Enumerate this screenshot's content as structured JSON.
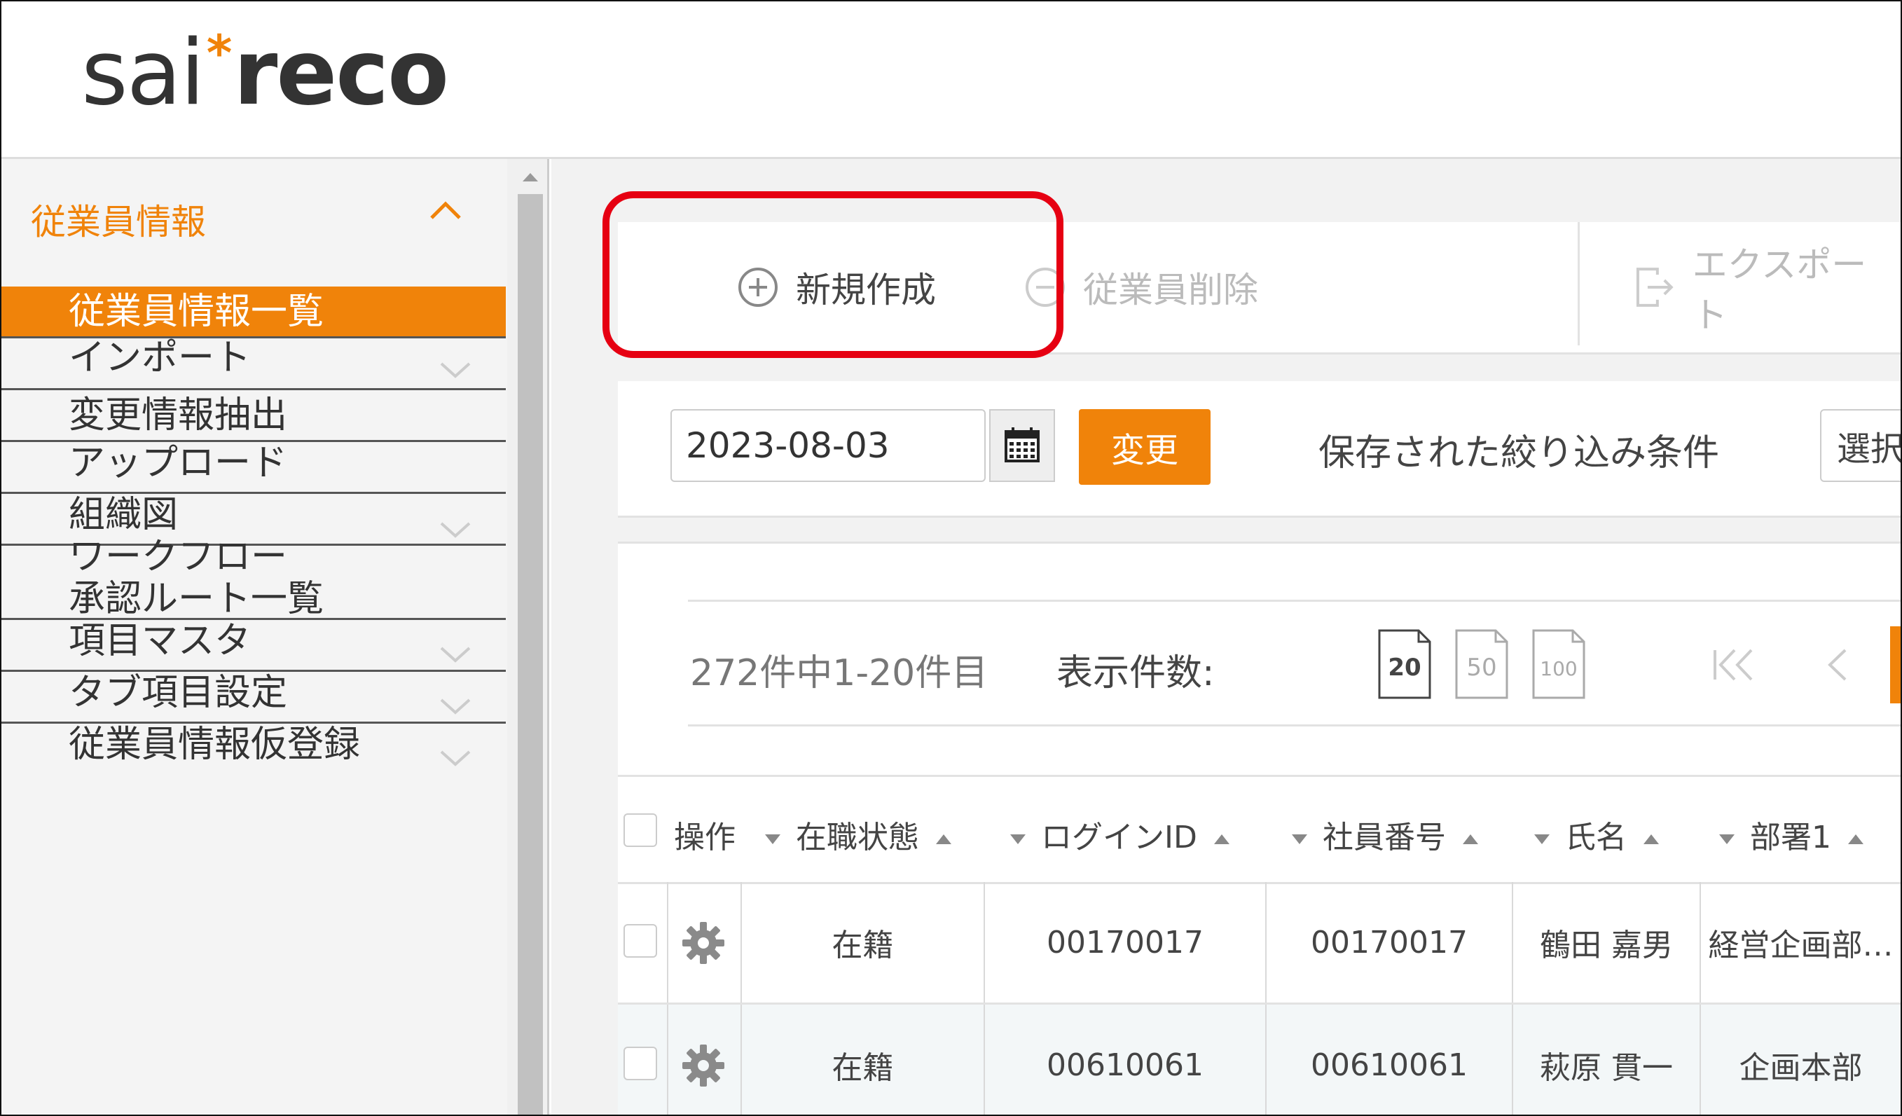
{
  "logo": {
    "part1": "sai",
    "star": "*",
    "part2": "reco"
  },
  "sidebar": {
    "section_label": "従業員情報",
    "items": [
      {
        "label": "従業員情報一覧",
        "active": true,
        "has_chevron": false
      },
      {
        "label": "インポート",
        "active": false,
        "has_chevron": true
      },
      {
        "label": "変更情報抽出",
        "active": false,
        "has_chevron": false
      },
      {
        "label": "アップロード",
        "active": false,
        "has_chevron": false
      },
      {
        "label": "組織図",
        "active": false,
        "has_chevron": true
      },
      {
        "label": "ワークフロー\n承認ルート一覧",
        "active": false,
        "has_chevron": false
      },
      {
        "label": "項目マスタ",
        "active": false,
        "has_chevron": true
      },
      {
        "label": "タブ項目設定",
        "active": false,
        "has_chevron": true
      },
      {
        "label": "従業員情報仮登録",
        "active": false,
        "has_chevron": true
      }
    ]
  },
  "toolbar": {
    "new_label": "新規作成",
    "delete_label": "従業員削除",
    "export_label": "エクスポート"
  },
  "filter": {
    "date_value": "2023-08-03",
    "change_label": "変更",
    "saved_conditions_label": "保存された絞り込み条件",
    "select_value": "選択"
  },
  "pager": {
    "count_text": "272件中1-20件目",
    "per_page_label": "表示件数:",
    "per_page_options": [
      "20",
      "50",
      "100"
    ],
    "per_page_selected": "20"
  },
  "table": {
    "headers": {
      "op": "操作",
      "status": "在職状態",
      "login_id": "ログインID",
      "emp_no": "社員番号",
      "name": "氏名",
      "dept": "部署1"
    },
    "rows": [
      {
        "status": "在籍",
        "login_id": "00170017",
        "emp_no": "00170017",
        "name": "鶴田 嘉男",
        "dept": "経営企画部…"
      },
      {
        "status": "在籍",
        "login_id": "00610061",
        "emp_no": "00610061",
        "name": "萩原 貫一",
        "dept": "企画本部"
      }
    ]
  },
  "colors": {
    "accent": "#f0830a",
    "highlight": "#e60012"
  }
}
